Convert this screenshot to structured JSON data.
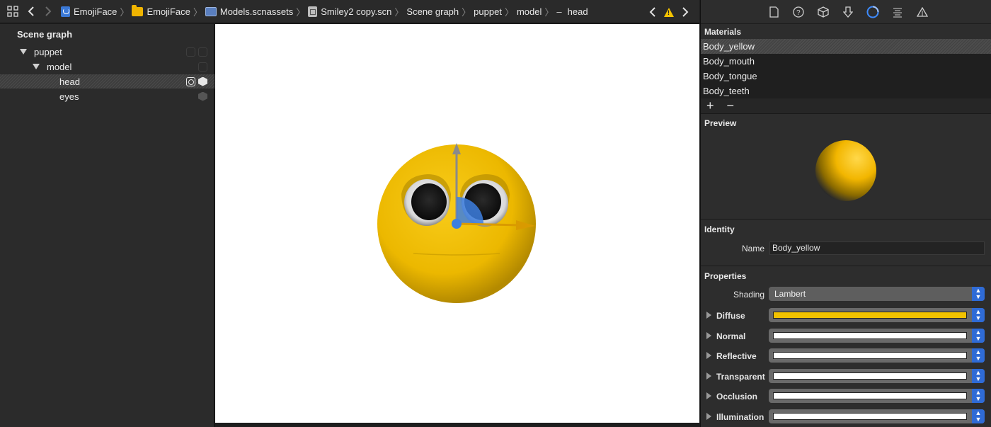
{
  "breadcrumbs": [
    "EmojiFace",
    "EmojiFace",
    "Models.scnassets",
    "Smiley2 copy.scn",
    "Scene graph",
    "puppet",
    "model",
    "head"
  ],
  "scene_graph": {
    "title": "Scene graph",
    "nodes": [
      {
        "label": "puppet"
      },
      {
        "label": "model"
      },
      {
        "label": "head"
      },
      {
        "label": "eyes"
      }
    ]
  },
  "inspector": {
    "materials_title": "Materials",
    "materials": [
      "Body_yellow",
      "Body_mouth",
      "Body_tongue",
      "Body_teeth"
    ],
    "add_label": "+",
    "remove_label": "−",
    "preview_title": "Preview",
    "identity_title": "Identity",
    "name_label": "Name",
    "name_value": "Body_yellow",
    "properties_title": "Properties",
    "shading_label": "Shading",
    "shading_value": "Lambert",
    "properties": [
      {
        "name": "Diffuse",
        "color": "#f2c200"
      },
      {
        "name": "Normal",
        "color": "#ffffff"
      },
      {
        "name": "Reflective",
        "color": "#ffffff"
      },
      {
        "name": "Transparent",
        "color": "#ffffff"
      },
      {
        "name": "Occlusion",
        "color": "#ffffff"
      },
      {
        "name": "Illumination",
        "color": "#ffffff"
      }
    ]
  },
  "colors": {
    "accent": "#3d8bff",
    "emoji_yellow": "#f2c200",
    "gizmo_blue": "#3d7fe0",
    "gizmo_orange": "#d99a00"
  }
}
